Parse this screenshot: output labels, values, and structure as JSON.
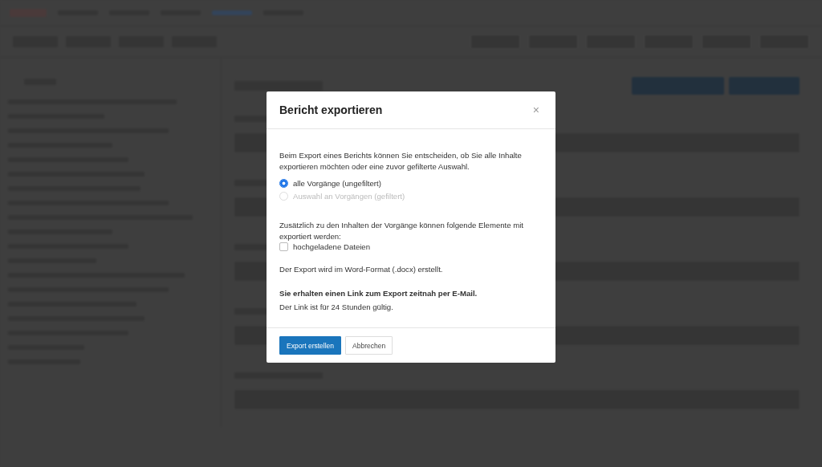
{
  "dialog": {
    "title": "Bericht exportieren",
    "close": "×",
    "intro": "Beim Export eines Berichts können Sie entscheiden, ob Sie alle Inhalte exportieren möchten oder eine zuvor gefilterte Auswahl.",
    "options": [
      {
        "label": "alle Vorgänge (ungefiltert)",
        "selected": true,
        "disabled": false
      },
      {
        "label": "Auswahl an Vorgängen (gefiltert)",
        "selected": false,
        "disabled": true
      }
    ],
    "extras_intro": "Zusätzlich zu den Inhalten der Vorgänge können folgende Elemente mit exportiert werden:",
    "extras": [
      {
        "label": "hochgeladene Dateien",
        "checked": false
      }
    ],
    "format_note": "Der Export wird im Word-Format (.docx) erstellt.",
    "email_note": "Sie erhalten einen Link zum Export zeitnah per E-Mail.",
    "validity_note": "Der Link ist für 24 Stunden gültig.",
    "buttons": [
      {
        "label": "Export erstellen",
        "kind": "primary"
      },
      {
        "label": "Abbrechen",
        "kind": "secondary"
      }
    ]
  }
}
